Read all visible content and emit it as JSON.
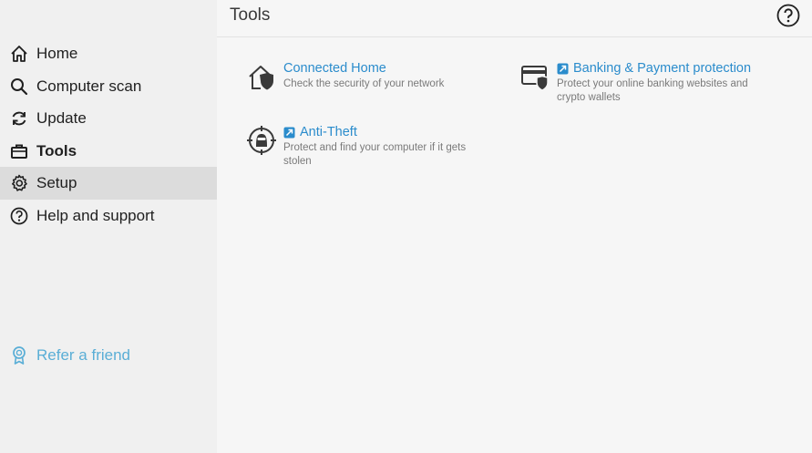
{
  "sidebar": {
    "items": [
      {
        "label": "Home",
        "icon": "home-icon"
      },
      {
        "label": "Computer scan",
        "icon": "search-icon"
      },
      {
        "label": "Update",
        "icon": "refresh-icon"
      },
      {
        "label": "Tools",
        "icon": "briefcase-icon",
        "active": true
      },
      {
        "label": "Setup",
        "icon": "gear-icon"
      },
      {
        "label": "Help and support",
        "icon": "help-circle-icon"
      }
    ],
    "refer": {
      "label": "Refer a friend",
      "icon": "award-icon"
    }
  },
  "main": {
    "title": "Tools",
    "tools": [
      {
        "name": "Connected Home",
        "description": "Check the security of your network",
        "icon": "home-shield-icon",
        "external": false
      },
      {
        "name": "Banking & Payment protection",
        "description": "Protect your online banking websites and crypto wallets",
        "icon": "card-shield-icon",
        "external": true
      },
      {
        "name": "Anti-Theft",
        "description": "Protect and find your computer if it gets stolen",
        "icon": "target-thief-icon",
        "external": true
      }
    ]
  },
  "colors": {
    "accent": "#2b8ccc",
    "refer": "#5aaed6",
    "hover": "#dcdcdc"
  }
}
